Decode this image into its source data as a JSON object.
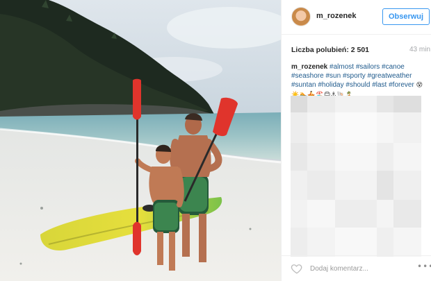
{
  "post": {
    "username": "m_rozenek",
    "follow_label": "Obserwuj",
    "likes_text": "Liczba polubień: 2 501",
    "time_text": "43 min",
    "caption": {
      "username": "m_rozenek",
      "hashtags": "#almost #sailors #canoe #seashore #sun #sporty #greatweather #suntan #holiday #should #last #forever",
      "emojis": "😵☀️🏊🚣🏖️😊⚓🐚🏝️"
    },
    "comment_placeholder": "Dodaj komentarz...",
    "more_label": "•••"
  },
  "icons": {
    "like": "heart-outline-icon",
    "more": "more-options-icon"
  },
  "colors": {
    "accent": "#3897f0",
    "hashtag": "#1f5a8c",
    "muted": "#a5a7aa"
  }
}
